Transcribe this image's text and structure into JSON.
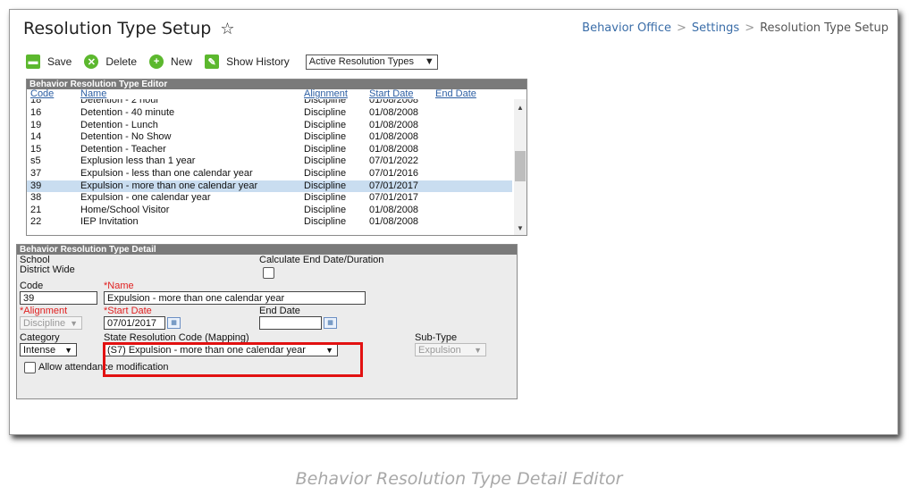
{
  "header": {
    "title": "Resolution Type Setup",
    "star_icon": "☆",
    "breadcrumb": [
      "Behavior Office",
      "Settings",
      "Resolution Type Setup"
    ],
    "breadcrumb_sep": ">"
  },
  "toolbar": {
    "save_label": "Save",
    "delete_label": "Delete",
    "new_label": "New",
    "history_label": "Show History",
    "filter_value": "Active Resolution Types",
    "icon_color": "#5cb82e"
  },
  "editor": {
    "title": "Behavior Resolution Type Editor",
    "columns": [
      "Code",
      "Name",
      "Alignment",
      "Start Date",
      "End Date"
    ],
    "rows": [
      {
        "code": "18",
        "name": "Detention - 2 hour",
        "alignment": "Discipline",
        "start": "01/08/2008",
        "end": "",
        "partial": true
      },
      {
        "code": "16",
        "name": "Detention - 40 minute",
        "alignment": "Discipline",
        "start": "01/08/2008",
        "end": ""
      },
      {
        "code": "19",
        "name": "Detention - Lunch",
        "alignment": "Discipline",
        "start": "01/08/2008",
        "end": ""
      },
      {
        "code": "14",
        "name": "Detention - No Show",
        "alignment": "Discipline",
        "start": "01/08/2008",
        "end": ""
      },
      {
        "code": "15",
        "name": "Detention - Teacher",
        "alignment": "Discipline",
        "start": "01/08/2008",
        "end": ""
      },
      {
        "code": "s5",
        "name": "Explusion less than 1 year",
        "alignment": "Discipline",
        "start": "07/01/2022",
        "end": ""
      },
      {
        "code": "37",
        "name": "Expulsion - less than one calendar year",
        "alignment": "Discipline",
        "start": "07/01/2016",
        "end": ""
      },
      {
        "code": "39",
        "name": "Expulsion - more than one calendar year",
        "alignment": "Discipline",
        "start": "07/01/2017",
        "end": "",
        "selected": true
      },
      {
        "code": "38",
        "name": "Expulsion - one calendar year",
        "alignment": "Discipline",
        "start": "07/01/2017",
        "end": ""
      },
      {
        "code": "21",
        "name": "Home/School Visitor",
        "alignment": "Discipline",
        "start": "01/08/2008",
        "end": ""
      },
      {
        "code": "22",
        "name": "IEP Invitation",
        "alignment": "Discipline",
        "start": "01/08/2008",
        "end": ""
      }
    ],
    "selected_color": "#c9ddf0"
  },
  "detail": {
    "title": "Behavior Resolution Type Detail",
    "school_label": "School",
    "school_value": "District Wide",
    "calc_label": "Calculate End Date/Duration",
    "code_label": "Code",
    "code_value": "39",
    "name_label": "*Name",
    "name_value": "Expulsion - more than one calendar year",
    "alignment_label": "*Alignment",
    "alignment_value": "Discipline",
    "start_label": "*Start Date",
    "start_value": "07/01/2017",
    "end_label": "End Date",
    "end_value": "",
    "category_label": "Category",
    "category_value": "Intense",
    "state_label": "State Resolution Code (Mapping)",
    "state_value": "(S7) Expulsion - more than one calendar year",
    "subtype_label": "Sub-Type",
    "subtype_value": "Expulsion",
    "attendance_label": "Allow attendance modification"
  },
  "caption": "Behavior Resolution Type Detail Editor"
}
